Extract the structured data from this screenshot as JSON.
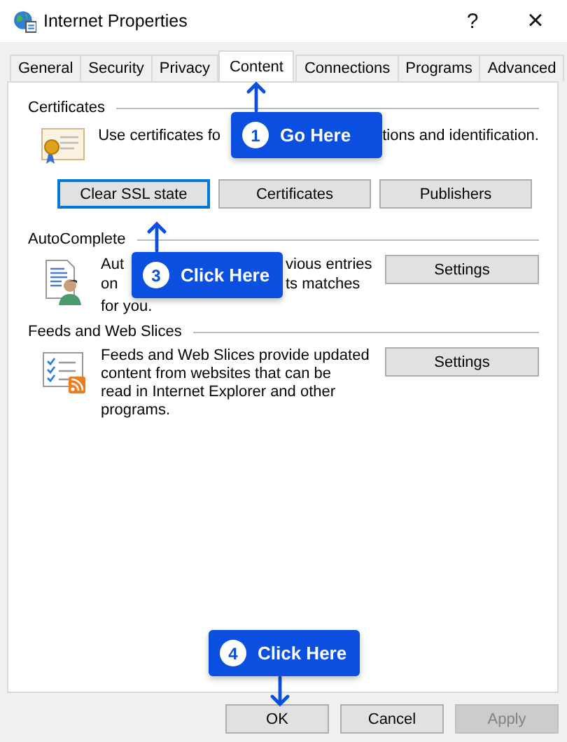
{
  "window": {
    "title": "Internet Properties",
    "help": "?",
    "close": "×"
  },
  "tabs": [
    {
      "label": "General",
      "selected": false
    },
    {
      "label": "Security",
      "selected": false
    },
    {
      "label": "Privacy",
      "selected": false
    },
    {
      "label": "Content",
      "selected": true
    },
    {
      "label": "Connections",
      "selected": false
    },
    {
      "label": "Programs",
      "selected": false
    },
    {
      "label": "Advanced",
      "selected": false
    }
  ],
  "sections": [
    {
      "kind": "certificates",
      "heading": "Certificates",
      "lines": [
        [
          "Use certificates fo",
          "tions and identification."
        ]
      ],
      "buttons": [
        {
          "label": "Clear SSL state",
          "focused": true
        },
        {
          "label": "Certificates",
          "focused": false
        },
        {
          "label": "Publishers",
          "focused": false
        }
      ]
    },
    {
      "kind": "autocomplete",
      "heading": "AutoComplete",
      "lines": [
        [
          "Aut",
          "vious entries"
        ],
        [
          "on",
          "ts matches"
        ],
        [
          "for you."
        ]
      ],
      "buttons": [
        {
          "label": "Settings",
          "focused": false
        }
      ]
    },
    {
      "kind": "feeds",
      "heading": "Feeds and Web Slices",
      "text": "Feeds and Web Slices provide updated\ncontent from websites that can be\nread in Internet Explorer and other\nprograms.",
      "buttons": [
        {
          "label": "Settings",
          "focused": false
        }
      ]
    }
  ],
  "dialog_buttons": [
    {
      "label": "OK",
      "disabled": false
    },
    {
      "label": "Cancel",
      "disabled": false
    },
    {
      "label": "Apply",
      "disabled": true
    }
  ],
  "callouts": [
    {
      "number": "1",
      "label": "Go Here",
      "kind": "arrow-up"
    },
    {
      "number": "3",
      "label": "Click Here",
      "kind": "arrow-up"
    },
    {
      "number": "4",
      "label": "Click Here",
      "kind": "arrow-down"
    }
  ]
}
